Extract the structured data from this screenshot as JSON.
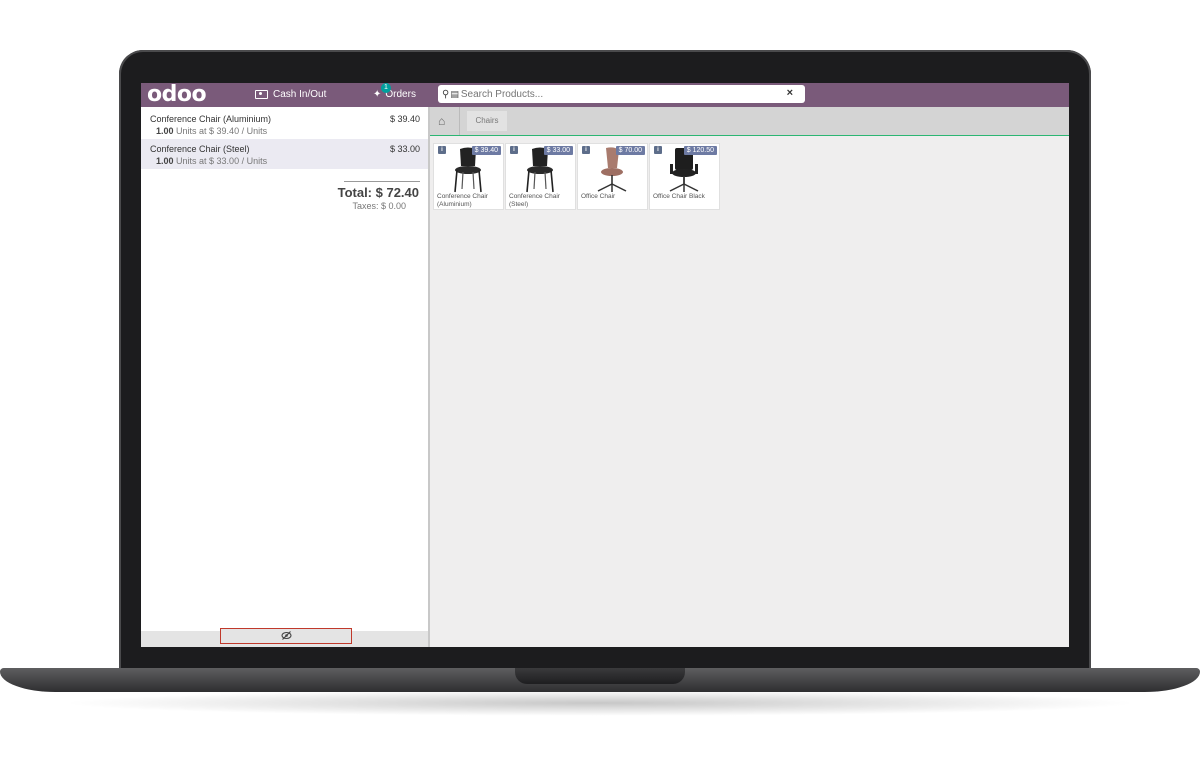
{
  "topbar": {
    "logo": "odoo",
    "cash_in_out": "Cash In/Out",
    "orders_label": "Orders",
    "orders_count": "1",
    "search_placeholder": "Search Products...",
    "clear_symbol": "×"
  },
  "order": {
    "lines": [
      {
        "name": "Conference Chair (Aluminium)",
        "price": "$ 39.40",
        "qty": "1.00",
        "info": " Units at $ 39.40 / Units"
      },
      {
        "name": "Conference Chair (Steel)",
        "price": "$ 33.00",
        "qty": "1.00",
        "info": " Units at $ 33.00 / Units"
      }
    ],
    "total": "Total: $ 72.40",
    "taxes": "Taxes: $ 0.00"
  },
  "breadcrumb": {
    "category": "Chairs"
  },
  "products": [
    {
      "name": "Conference Chair (Aluminium)",
      "price": "$ 39.40",
      "image": "black-conference-chair"
    },
    {
      "name": "Conference Chair (Steel)",
      "price": "$ 33.00",
      "image": "black-conference-chair"
    },
    {
      "name": "Office Chair",
      "price": "$ 70.00",
      "image": "brown-office-chair"
    },
    {
      "name": "Office Chair Black",
      "price": "$ 120.50",
      "image": "black-executive-chair"
    }
  ],
  "colors": {
    "topbar": "#7a5a7a",
    "selected_line": "#ebeaf2",
    "price_tag": "#6d7aa3",
    "highlight_border": "#c0392b"
  }
}
